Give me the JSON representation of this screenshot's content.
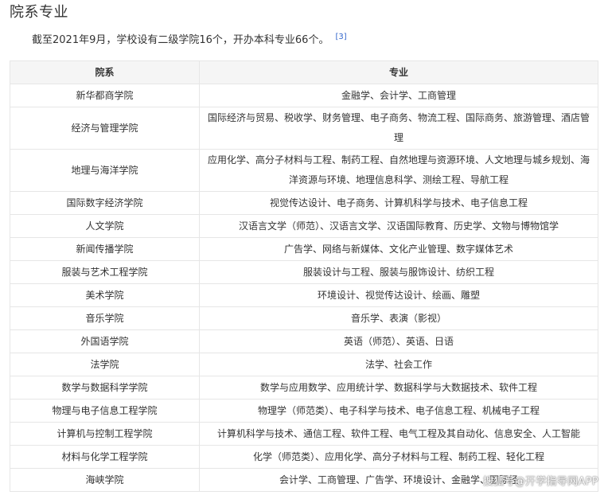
{
  "section": {
    "title": "院系专业",
    "intro": "截至2021年9月，学校设有二级学院16个，开办本科专业66个。",
    "citation": "[3]"
  },
  "table": {
    "headers": [
      "院系",
      "专业"
    ],
    "rows": [
      {
        "college": "新华都商学院",
        "majors": "金融学、会计学、工商管理"
      },
      {
        "college": "经济与管理学院",
        "majors": "国际经济与贸易、税收学、财务管理、电子商务、物流工程、国际商务、旅游管理、酒店管理"
      },
      {
        "college": "地理与海洋学院",
        "majors": "应用化学、高分子材料与工程、制药工程、自然地理与资源环境、人文地理与城乡规划、海洋资源与环境、地理信息科学、测绘工程、导航工程"
      },
      {
        "college": "国际数字经济学院",
        "majors": "视觉传达设计、电子商务、计算机科学与技术、电子信息工程"
      },
      {
        "college": "人文学院",
        "majors": "汉语言文学（师范）、汉语言文学、汉语国际教育、历史学、文物与博物馆学"
      },
      {
        "college": "新闻传播学院",
        "majors": "广告学、网络与新媒体、文化产业管理、数字媒体艺术"
      },
      {
        "college": "服装与艺术工程学院",
        "majors": "服装设计与工程、服装与服饰设计、纺织工程"
      },
      {
        "college": "美术学院",
        "majors": "环境设计、视觉传达设计、绘画、雕塑"
      },
      {
        "college": "音乐学院",
        "majors": "音乐学、表演（影视）"
      },
      {
        "college": "外国语学院",
        "majors": "英语（师范）、英语、日语"
      },
      {
        "college": "法学院",
        "majors": "法学、社会工作"
      },
      {
        "college": "数学与数据科学学院",
        "majors": "数学与应用数学、应用统计学、数据科学与大数据技术、软件工程"
      },
      {
        "college": "物理与电子信息工程学院",
        "majors": "物理学（师范类）、电子科学与技术、电子信息工程、机械电子工程"
      },
      {
        "college": "计算机与控制工程学院",
        "majors": "计算机科学与技术、通信工程、软件工程、电气工程及其自动化、信息安全、人工智能"
      },
      {
        "college": "材料与化学工程学院",
        "majors": "化学（师范类）、应用化学、高分子材料与工程、制药工程、轻化工程"
      },
      {
        "college": "海峡学院",
        "majors": "会计学、工商管理、广告学、环境设计、金融学、国际经"
      }
    ]
  },
  "watermark": "搜狐号@开学指导网APP"
}
